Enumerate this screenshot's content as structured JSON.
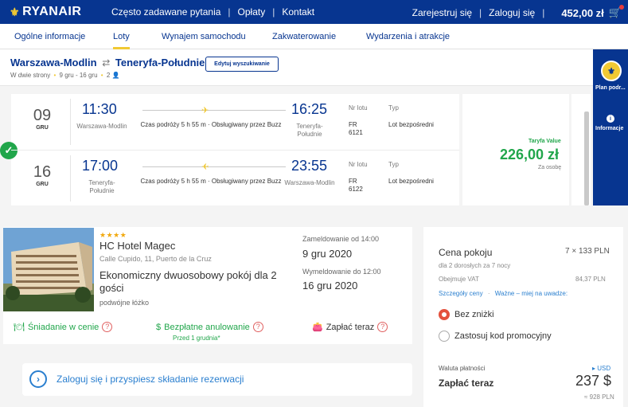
{
  "header": {
    "logo_text": "RYANAIR",
    "nav": [
      "Często zadawane pytania",
      "Opłaty",
      "Kontakt"
    ],
    "register": "Zarejestruj się",
    "login": "Zaloguj się",
    "balance": "452,00 zł"
  },
  "tabs": [
    "Ogólne informacje",
    "Loty",
    "Wynajem samochodu",
    "Zakwaterowanie",
    "Wydarzenia i atrakcje"
  ],
  "route": {
    "origin": "Warszawa-Modlin",
    "destination": "Teneryfa-Południe",
    "edit_label": "Edytuj wyszukiwanie",
    "trip_type": "W dwie strony",
    "dates": "9 gru - 16 gru",
    "passengers": "2"
  },
  "side": {
    "plan_label": "Plan podr...",
    "info_label": "Informacje"
  },
  "flights": [
    {
      "day": "09",
      "month": "GRU",
      "dep_time": "11:30",
      "dep_city": "Warszawa-Modlin",
      "arr_time": "16:25",
      "arr_city": "Teneryfa-Południe",
      "duration": "Czas podróży 5 h 55 m · Obsługiwany przez Buzz",
      "flight_no_label": "Nr lotu",
      "flight_code": "FR",
      "flight_no": "6121",
      "type_label": "Typ",
      "type": "Lot bezpośredni"
    },
    {
      "day": "16",
      "month": "GRU",
      "dep_time": "17:00",
      "dep_city": "Teneryfa-Południe",
      "arr_time": "23:55",
      "arr_city": "Warszawa-Modlin",
      "duration": "Czas podróży 5 h 55 m · Obsługiwany przez Buzz",
      "flight_no_label": "Nr lotu",
      "flight_code": "FR",
      "flight_no": "6122",
      "type_label": "Typ",
      "type": "Lot bezpośredni"
    }
  ],
  "fare": {
    "name": "Taryfa Value",
    "price": "226,00 zł",
    "per": "Za osobę"
  },
  "hotel": {
    "stars": "★★★★",
    "name": "HC Hotel Magec",
    "address": "Calle Cupido, 11, Puerto de la Cruz",
    "room": "Ekonomiczny dwuosobowy pokój dla 2 gości",
    "bed": "podwójne łóżko",
    "checkin_label": "Zameldowanie od 14:00",
    "checkin_date": "9 gru 2020",
    "checkout_label": "Wymeldowanie do 12:00",
    "checkout_date": "16 gru 2020",
    "perk_breakfast": "Śniadanie w cenie",
    "perk_cancel": "Bezpłatne anulowanie",
    "perk_cancel_sub": "Przed 1 grudnia*",
    "perk_pay": "Zapłać teraz",
    "help_mark": "?"
  },
  "login_banner": "Zaloguj się i przyspiesz składanie rezerwacji",
  "pricing": {
    "title": "Cena pokoju",
    "rate": "7 × 133 PLN",
    "guests": "dla 2 dorosłych",
    "nights": "za 7 nocy",
    "vat_label": "Obejmuje VAT",
    "vat_value": "84,37 PLN",
    "details_link": "Szczegóły ceny",
    "important_link": "Ważne – miej na uwadze:",
    "option_no_discount": "Bez zniżki",
    "option_promo": "Zastosuj kod promocyjny",
    "currency_label": "Waluta płatności",
    "currency_value": "USD",
    "pay_label": "Zapłać teraz",
    "total": "237 $",
    "converted": "≈ 928 PLN"
  },
  "colors": {
    "brand_blue": "#073590",
    "brand_yellow": "#f1c933",
    "success_green": "#21a64b",
    "link_blue": "#2a7fcf",
    "radio_red": "#e4513d"
  }
}
